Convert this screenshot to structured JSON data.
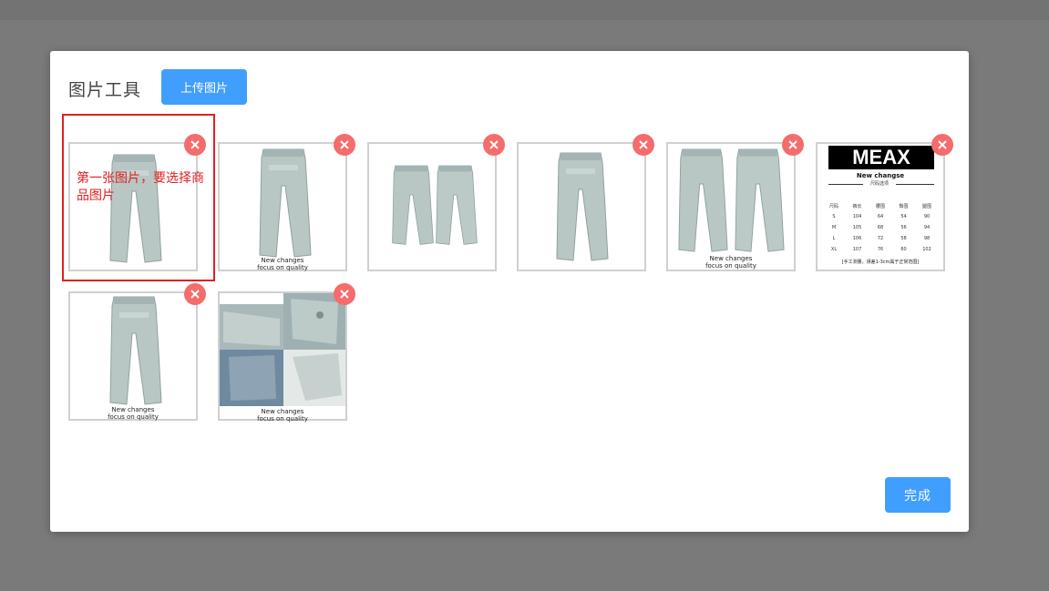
{
  "modal": {
    "title": "图片工具",
    "upload_label": "上传图片",
    "done_label": "完成"
  },
  "annotation": {
    "text": "第一张图片，要选择商品图片"
  },
  "images": [
    {
      "kind": "single-jeans",
      "caption1": "",
      "caption2": ""
    },
    {
      "kind": "single-jeans",
      "caption1": "New  changes",
      "caption2": "focus  on quality"
    },
    {
      "kind": "double-jeans",
      "caption1": "",
      "caption2": ""
    },
    {
      "kind": "single-jeans",
      "caption1": "",
      "caption2": ""
    },
    {
      "kind": "double-jeans",
      "caption1": "New  changes",
      "caption2": "focus  on quality"
    },
    {
      "kind": "size-chart",
      "brand": "MEAX",
      "subtitle": "New  changse",
      "line": "尺码选项",
      "note": "[手工测量，误差1-3cm属于正常范围]"
    },
    {
      "kind": "single-jeans",
      "caption1": "New  changes",
      "caption2": "focus  on quality"
    },
    {
      "kind": "collage",
      "caption1": "New  changes",
      "caption2": "focus  on quality"
    }
  ],
  "size_chart": {
    "headers": [
      "尺码",
      "裤长",
      "腰围",
      "臀围",
      "腿围"
    ],
    "rows": [
      [
        "S",
        "104",
        "64",
        "54",
        "90"
      ],
      [
        "M",
        "105",
        "68",
        "56",
        "94"
      ],
      [
        "L",
        "106",
        "72",
        "58",
        "98"
      ],
      [
        "XL",
        "107",
        "76",
        "60",
        "102"
      ]
    ]
  },
  "colors": {
    "accent": "#409eff",
    "delete": "#f56c6c",
    "annotation": "#e02020",
    "denim": "#b9c7c4"
  },
  "icons": {
    "delete": "close-icon"
  }
}
